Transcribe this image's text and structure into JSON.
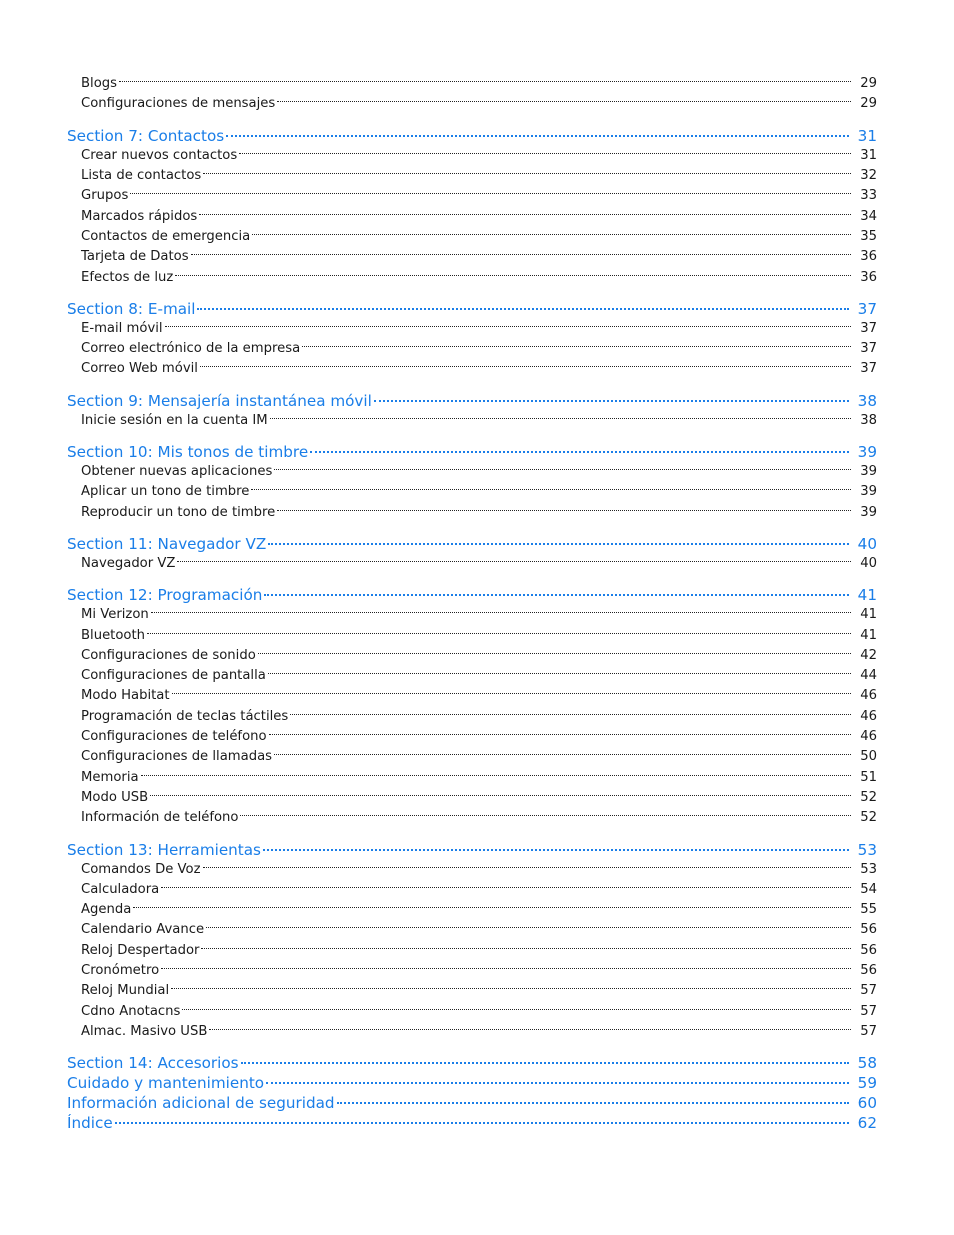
{
  "colors": {
    "section": "#1a7ee8",
    "entry": "#1a1a1a"
  },
  "toc": [
    {
      "type": "entries",
      "items": [
        {
          "label": "Blogs",
          "page": "29"
        },
        {
          "label": "Configuraciones de mensajes",
          "page": "29"
        }
      ]
    },
    {
      "type": "section",
      "label": "Section 7:  Contactos",
      "page": "31",
      "items": [
        {
          "label": "Crear nuevos contactos",
          "page": "31"
        },
        {
          "label": "Lista de contactos",
          "page": "32"
        },
        {
          "label": "Grupos",
          "page": "33"
        },
        {
          "label": "Marcados rápidos",
          "page": "34"
        },
        {
          "label": "Contactos de emergencia",
          "page": "35"
        },
        {
          "label": "Tarjeta de Datos",
          "page": "36"
        },
        {
          "label": "Efectos de luz",
          "page": "36"
        }
      ]
    },
    {
      "type": "section",
      "label": "Section 8:  E-mail",
      "page": "37",
      "items": [
        {
          "label": "E-mail móvil",
          "page": "37"
        },
        {
          "label": "Correo electrónico de la empresa",
          "page": "37"
        },
        {
          "label": "Correo Web móvil",
          "page": "37"
        }
      ]
    },
    {
      "type": "section",
      "label": "Section 9:  Mensajería instantánea móvil",
      "page": "38",
      "items": [
        {
          "label": "Inicie sesión en la cuenta IM",
          "page": "38"
        }
      ]
    },
    {
      "type": "section",
      "label": "Section 10:  Mis tonos de timbre",
      "page": "39",
      "items": [
        {
          "label": "Obtener nuevas aplicaciones",
          "page": "39"
        },
        {
          "label": "Aplicar un tono de timbre",
          "page": "39"
        },
        {
          "label": "Reproducir un tono de timbre",
          "page": "39"
        }
      ]
    },
    {
      "type": "section",
      "label": "Section 11:  Navegador VZ",
      "page": "40",
      "items": [
        {
          "label": "Navegador VZ",
          "page": "40"
        }
      ]
    },
    {
      "type": "section",
      "label": "Section 12:  Programación",
      "page": "41",
      "items": [
        {
          "label": "Mi Verizon",
          "page": "41"
        },
        {
          "label": "Bluetooth",
          "page": "41"
        },
        {
          "label": "Configuraciones de sonido",
          "page": "42"
        },
        {
          "label": "Configuraciones de pantalla",
          "page": "44"
        },
        {
          "label": "Modo Habitat",
          "page": "46"
        },
        {
          "label": "Programación de teclas táctiles",
          "page": "46"
        },
        {
          "label": "Configuraciones de teléfono",
          "page": "46"
        },
        {
          "label": "Configuraciones de llamadas",
          "page": "50"
        },
        {
          "label": "Memoria",
          "page": "51"
        },
        {
          "label": "Modo USB",
          "page": "52"
        },
        {
          "label": "Información de teléfono",
          "page": "52"
        }
      ]
    },
    {
      "type": "section",
      "label": "Section 13:  Herramientas",
      "page": "53",
      "items": [
        {
          "label": "Comandos De Voz",
          "page": "53"
        },
        {
          "label": "Calculadora",
          "page": "54"
        },
        {
          "label": "Agenda",
          "page": "55"
        },
        {
          "label": "Calendario Avance",
          "page": "56"
        },
        {
          "label": "Reloj Despertador",
          "page": "56"
        },
        {
          "label": "Cronómetro",
          "page": "56"
        },
        {
          "label": "Reloj Mundial",
          "page": "57"
        },
        {
          "label": "Cdno Anotacns",
          "page": "57"
        },
        {
          "label": "Almac. Masivo USB",
          "page": "57"
        }
      ]
    },
    {
      "type": "section",
      "label": "Section 14:  Accesorios",
      "page": "58",
      "items": []
    },
    {
      "type": "section",
      "label": "Cuidado y mantenimiento",
      "page": "59",
      "items": [],
      "nogap": true
    },
    {
      "type": "section",
      "label": "Información adicional de seguridad",
      "page": "60",
      "items": [],
      "nogap": true
    },
    {
      "type": "section",
      "label": "Índice",
      "page": "62",
      "items": [],
      "nogap": true
    }
  ]
}
